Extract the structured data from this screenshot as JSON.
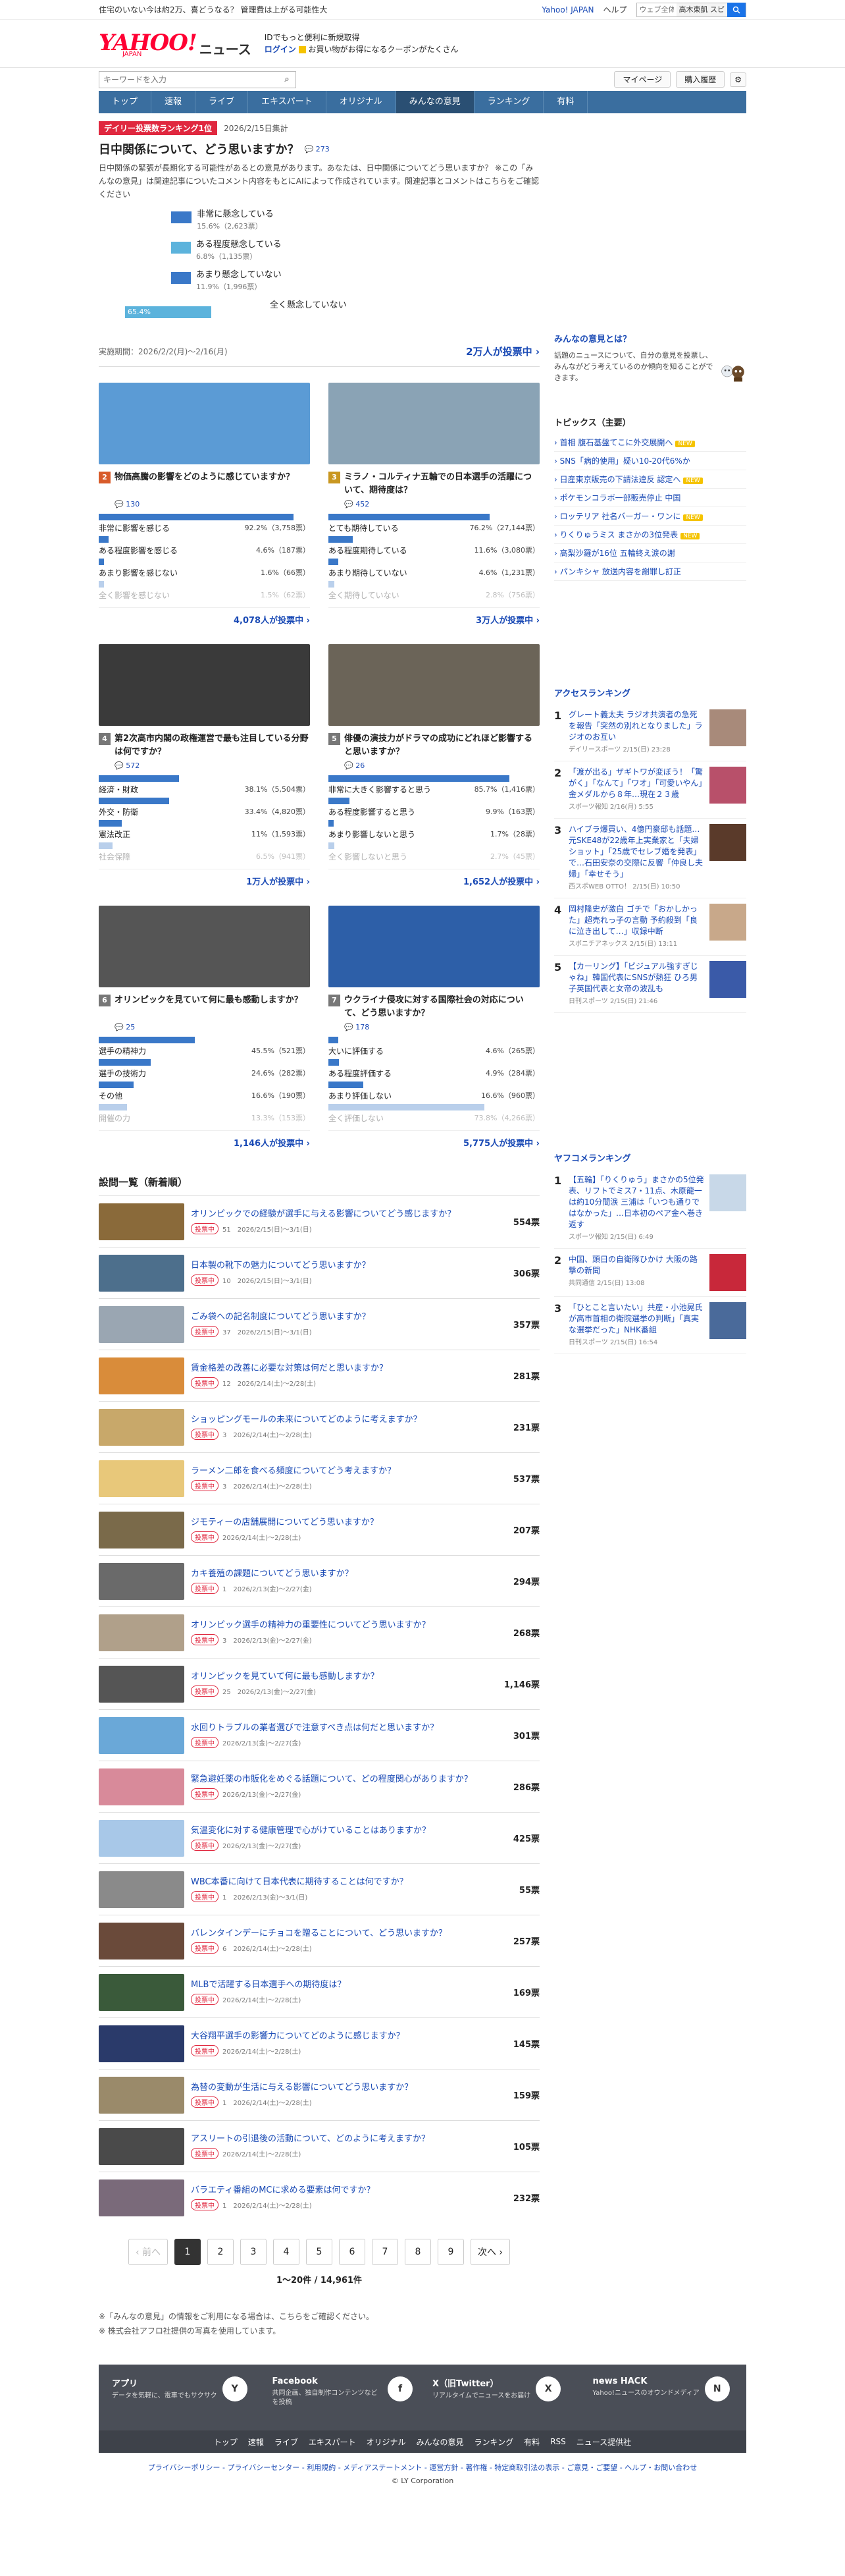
{
  "promo": {
    "left": "住宅のいない今は約2万、喜どうなる？ 管理費は上がる可能性大",
    "yj": "Yahoo! JAPAN",
    "help": "ヘルプ",
    "search_placeholder": "ウェブ全体",
    "search_tag": "高木東凱 スピ"
  },
  "header": {
    "logo": "YAHOO!",
    "logo_jp": "JAPAN",
    "section": "ニュース",
    "line1": "IDでもっと便利に新規取得",
    "line2a": "ログイン",
    "line2b": "お買い物がお得になるクーポンがたくさん"
  },
  "searchbar": {
    "placeholder": "キーワードを入力",
    "mypage": "マイページ",
    "history": "購入履歴"
  },
  "nav": [
    "トップ",
    "速報",
    "ライブ",
    "エキスパート",
    "オリジナル",
    "みんなの意見",
    "ランキング",
    "有料"
  ],
  "featured": {
    "badge": "デイリー投票数ランキング1位",
    "date": "2026/2/15日集計",
    "title": "日中関係について、どう思いますか？",
    "comments": "273",
    "desc": "日中関係の緊張が長期化する可能性があるとの意見があります。あなたは、日中関係についてどう思いますか？ ※この「みんなの意見」は関連記事についたコメント内容をもとにAIによって作成されています。関連記事とコメントはこちらをご確認ください",
    "options": [
      {
        "label": "非常に懸念している",
        "pct": "15.6%（2,623票）",
        "value": 15.6
      },
      {
        "label": "ある程度懸念している",
        "pct": "6.8%（1,135票）",
        "value": 6.8
      },
      {
        "label": "あまり懸念していない",
        "pct": "11.9%（1,996票）",
        "value": 11.9
      },
      {
        "label": "全く懸念していない",
        "pct": "65.4%",
        "value": 65.4
      }
    ],
    "period": "実施期間：2026/2/2(月)～2/16(月)",
    "count": "2万人が投票中 ›"
  },
  "cards": [
    {
      "rank": "2",
      "title": "物価高騰の影響をどのように感じていますか？",
      "meta": "130",
      "img": "#5b9bd5",
      "options": [
        {
          "l": "非常に影響を感じる",
          "v": "92.2%（3,758票）",
          "w": 92.2
        },
        {
          "l": "ある程度影響を感じる",
          "v": "4.6%（187票）",
          "w": 4.6
        },
        {
          "l": "あまり影響を感じない",
          "v": "1.6%（66票）",
          "w": 1.6
        },
        {
          "l": "全く影響を感じない",
          "v": "1.5%（62票）",
          "w": 1.5
        }
      ],
      "count": "4,078人が投票中 ›"
    },
    {
      "rank": "3",
      "title": "ミラノ・コルティナ五輪での日本選手の活躍について、期待度は？",
      "meta": "452",
      "img": "#8aa3b5",
      "options": [
        {
          "l": "とても期待している",
          "v": "76.2%（27,144票）",
          "w": 76.2
        },
        {
          "l": "ある程度期待している",
          "v": "11.6%（3,080票）",
          "w": 11.6
        },
        {
          "l": "あまり期待していない",
          "v": "4.6%（1,231票）",
          "w": 4.6
        },
        {
          "l": "全く期待していない",
          "v": "2.8%（756票）",
          "w": 2.8
        }
      ],
      "count": "3万人が投票中 ›"
    },
    {
      "rank": "4",
      "title": "第2次高市内閣の政権運営で最も注目している分野は何ですか？",
      "meta": "572",
      "img": "#3a3a3a",
      "options": [
        {
          "l": "経済・財政",
          "v": "38.1%（5,504票）",
          "w": 38.1
        },
        {
          "l": "外交・防衛",
          "v": "33.4%（4,820票）",
          "w": 33.4
        },
        {
          "l": "憲法改正",
          "v": "11%（1,593票）",
          "w": 11
        },
        {
          "l": "社会保障",
          "v": "6.5%（941票）",
          "w": 6.5
        }
      ],
      "count": "1万人が投票中 ›"
    },
    {
      "rank": "5",
      "title": "俳優の演技力がドラマの成功にどれほど影響すると思いますか？",
      "meta": "26",
      "img": "#6b6458",
      "options": [
        {
          "l": "非常に大きく影響すると思う",
          "v": "85.7%（1,416票）",
          "w": 85.7
        },
        {
          "l": "ある程度影響すると思う",
          "v": "9.9%（163票）",
          "w": 9.9
        },
        {
          "l": "あまり影響しないと思う",
          "v": "1.7%（28票）",
          "w": 1.7
        },
        {
          "l": "全く影響しないと思う",
          "v": "2.7%（45票）",
          "w": 2.7
        }
      ],
      "count": "1,652人が投票中 ›"
    },
    {
      "rank": "6",
      "title": "オリンピックを見ていて何に最も感動しますか？",
      "meta": "25",
      "img": "#555",
      "options": [
        {
          "l": "選手の精神力",
          "v": "45.5%（521票）",
          "w": 45.5
        },
        {
          "l": "選手の技術力",
          "v": "24.6%（282票）",
          "w": 24.6
        },
        {
          "l": "その他",
          "v": "16.6%（190票）",
          "w": 16.6
        },
        {
          "l": "開催の力",
          "v": "13.3%（153票）",
          "w": 13.3
        }
      ],
      "count": "1,146人が投票中 ›"
    },
    {
      "rank": "7",
      "title": "ウクライナ侵攻に対する国際社会の対応について、どう思いますか？",
      "meta": "178",
      "img": "#2d5fa8",
      "options": [
        {
          "l": "大いに評価する",
          "v": "4.6%（265票）",
          "w": 4.6
        },
        {
          "l": "ある程度評価する",
          "v": "4.9%（284票）",
          "w": 4.9
        },
        {
          "l": "あまり評価しない",
          "v": "16.6%（960票）",
          "w": 16.6
        },
        {
          "l": "全く評価しない",
          "v": "73.8%（4,266票）",
          "w": 73.8
        }
      ],
      "count": "5,775人が投票中 ›"
    }
  ],
  "list_heading": "設問一覧（新着順）",
  "list": [
    {
      "q": "オリンピックでの経験が選手に与える影響についてどう感じますか？",
      "m": "51　2026/2/15(日)〜3/1(日)",
      "v": "554票",
      "c": "#8a6a3a"
    },
    {
      "q": "日本製の靴下の魅力についてどう思いますか？",
      "m": "10　2026/2/15(日)〜3/1(日)",
      "v": "306票",
      "c": "#4d6f8c"
    },
    {
      "q": "ごみ袋への記名制度についてどう思いますか？",
      "m": "37　2026/2/15(日)〜3/1(日)",
      "v": "357票",
      "c": "#9aa6b2"
    },
    {
      "q": "賃金格差の改善に必要な対策は何だと思いますか？",
      "m": "12　2026/2/14(土)〜2/28(土)",
      "v": "281票",
      "c": "#d98c3a"
    },
    {
      "q": "ショッピングモールの未来についてどのように考えますか？",
      "m": "3　2026/2/14(土)〜2/28(土)",
      "v": "231票",
      "c": "#c8a86a"
    },
    {
      "q": "ラーメン二郎を食べる頻度についてどう考えますか？",
      "m": "3　2026/2/14(土)〜2/28(土)",
      "v": "537票",
      "c": "#e8c87a"
    },
    {
      "q": "ジモティーの店舗展開についてどう思いますか？",
      "m": "2026/2/14(土)〜2/28(土)",
      "v": "207票",
      "c": "#7a6a4a"
    },
    {
      "q": "カキ養殖の課題についてどう思いますか？",
      "m": "1　2026/2/13(金)〜2/27(金)",
      "v": "294票",
      "c": "#6a6a6a"
    },
    {
      "q": "オリンピック選手の精神力の重要性についてどう思いますか？",
      "m": "3　2026/2/13(金)〜2/27(金)",
      "v": "268票",
      "c": "#b0a08a"
    },
    {
      "q": "オリンピックを見ていて何に最も感動しますか？",
      "m": "25　2026/2/13(金)〜2/27(金)",
      "v": "1,146票",
      "c": "#555"
    },
    {
      "q": "水回りトラブルの業者選びで注意すべき点は何だと思いますか？",
      "m": "2026/2/13(金)〜2/27(金)",
      "v": "301票",
      "c": "#6aa8d8"
    },
    {
      "q": "緊急避妊薬の市販化をめぐる話題について、どの程度関心がありますか？",
      "m": "2026/2/13(金)〜2/27(金)",
      "v": "286票",
      "c": "#d88a9a"
    },
    {
      "q": "気温変化に対する健康管理で心がけていることはありますか？",
      "m": "2026/2/13(金)〜2/27(金)",
      "v": "425票",
      "c": "#a8c8e8"
    },
    {
      "q": "WBC本番に向けて日本代表に期待することは何ですか？",
      "m": "1　2026/2/13(金)〜3/1(日)",
      "v": "55票",
      "c": "#8a8a8a"
    },
    {
      "q": "バレンタインデーにチョコを贈ることについて、どう思いますか？",
      "m": "6　2026/2/14(土)〜2/28(土)",
      "v": "257票",
      "c": "#6a4a3a"
    },
    {
      "q": "MLBで活躍する日本選手への期待度は？",
      "m": "2026/2/14(土)〜2/28(土)",
      "v": "169票",
      "c": "#3a5a3a"
    },
    {
      "q": "大谷翔平選手の影響力についてどのように感じますか？",
      "m": "2026/2/14(土)〜2/28(土)",
      "v": "145票",
      "c": "#2a3a6a"
    },
    {
      "q": "為替の変動が生活に与える影響についてどう思いますか？",
      "m": "1　2026/2/14(土)〜2/28(土)",
      "v": "159票",
      "c": "#9a8a6a"
    },
    {
      "q": "アスリートの引退後の活動について、どのように考えますか？",
      "m": "2026/2/14(土)〜2/28(土)",
      "v": "105票",
      "c": "#4a4a4a"
    },
    {
      "q": "バラエティ番組のMCに求める要素は何ですか？",
      "m": "1　2026/2/14(土)〜2/28(土)",
      "v": "232票",
      "c": "#7a6a7a"
    }
  ],
  "pager": {
    "prev": "‹ 前へ",
    "pages": [
      "1",
      "2",
      "3",
      "4",
      "5",
      "6",
      "7",
      "8",
      "9"
    ],
    "next": "次へ ›",
    "range": "1〜20件 / 14,961件"
  },
  "notes": [
    "※「みんなの意見」の情報をご利用になる場合は、こちらをご確認ください。",
    "※ 株式会社アフロ社提供の写真を使用しています。"
  ],
  "side": {
    "about_h": "みんなの意見とは？",
    "about_t": "話題のニュースについて、自分の意見を投票し、みんながどう考えているのか傾向を知ることができます。",
    "topics_h": "トピックス（主要）",
    "topics": [
      {
        "t": "首相 腹石基盤てこに外交展開へ",
        "n": true
      },
      {
        "t": "SNS「病的使用」疑い10-20代6%か",
        "n": false
      },
      {
        "t": "日産東京販売の下請法違反 認定へ",
        "n": true
      },
      {
        "t": "ポケモンコラボ一部販売停止 中国",
        "n": false
      },
      {
        "t": "ロッテリア 社名バーガー・ワンに",
        "n": true
      },
      {
        "t": "りくりゅうミス まさかの3位発表",
        "n": true
      },
      {
        "t": "高梨沙羅が16位 五輪終え涙の謝",
        "n": false
      },
      {
        "t": "パンキシャ 放送内容を謝罪し訂正",
        "n": false
      }
    ],
    "access_h": "アクセスランキング",
    "access": [
      {
        "t": "グレート義太夫 ラジオ共演者の急死を報告「突然の別れとなりました」ラジオのお互い",
        "s": "デイリースポーツ 2/15(日) 23:28",
        "c": "#a88a7a"
      },
      {
        "t": "「渡が出る」ザギトワが変ぼう！「驚がく」「なんて」「ワオ」「可愛いやん」金メダルから８年…現在２３歳",
        "s": "スポーツ報知 2/16(月) 5:55",
        "c": "#b8506a"
      },
      {
        "t": "ハイブラ爆買い、4億円豪邸も話題…元SKE48が22歳年上実業家と「夫婦ショット」「25歳でセレブ婚を発表」で…石田安奈の交際に反響「仲良し夫婦」「幸せそう」",
        "s": "西スポWEB OTTO！ 2/15(日) 10:50",
        "c": "#5a3a2a"
      },
      {
        "t": "岡村隆史が激白 ゴチで「おかしかった」超売れっ子の言動 予約殺到「良に泣き出して…」収録中断",
        "s": "スポニチアネックス 2/15(日) 13:11",
        "c": "#c8a88a"
      },
      {
        "t": "【カーリング】「ビジュアル強すぎじゃね」韓国代表にSNSが熱狂 ひろ男子英国代表と女帝の波乱も",
        "s": "日刊スポーツ 2/15(日) 21:46",
        "c": "#3a5aa8"
      }
    ],
    "yafuko_h": "ヤフコメランキング",
    "yafuko": [
      {
        "t": "【五輪】「りくりゅう」まさかの5位発表、リフトでミス7・11点、木原龍一は約10分間涙 三浦は「いつも通りではなかった」…日本初のペア金へ巻き返す",
        "s": "スポーツ報知 2/15(日) 6:49",
        "c": "#c8d8e8"
      },
      {
        "t": "中国、頭日の自衛隊ひかけ 大阪の路撃の新聞",
        "s": "共同通信 2/15(日) 13:08",
        "c": "#c8283a"
      },
      {
        "t": "「ひとこと言いたい」共産・小池晃氏が高市首相の衛院選挙の判断」「真実な選挙だった」NHK番組",
        "s": "日刊スポーツ 2/15(日) 16:54",
        "c": "#4a6a9a"
      }
    ]
  },
  "footer": {
    "items": [
      {
        "h": "アプリ",
        "t": "データを気軽に、電車でもサクサク",
        "i": "Y"
      },
      {
        "h": "Facebook",
        "t": "共同企画、独自制作コンテンツなどを投稿",
        "i": "f"
      },
      {
        "h": "X（旧Twitter）",
        "t": "リアルタイムでニュースをお届け",
        "i": "X"
      },
      {
        "h": "news HACK",
        "t": "Yahoo!ニュースのオウンドメディア",
        "i": "N"
      }
    ],
    "nav": [
      "トップ",
      "速報",
      "ライブ",
      "エキスパート",
      "オリジナル",
      "みんなの意見",
      "ランキング",
      "有料",
      "RSS",
      "ニュース提供社"
    ],
    "links": "プライバシーポリシー - プライバシーセンター - 利用規約 - メディアステートメント - 運営方針 - 著作権 - 特定商取引法の表示 - ご意見・ご要望 - ヘルプ・お問い合わせ",
    "copy": "© LY Corporation"
  }
}
